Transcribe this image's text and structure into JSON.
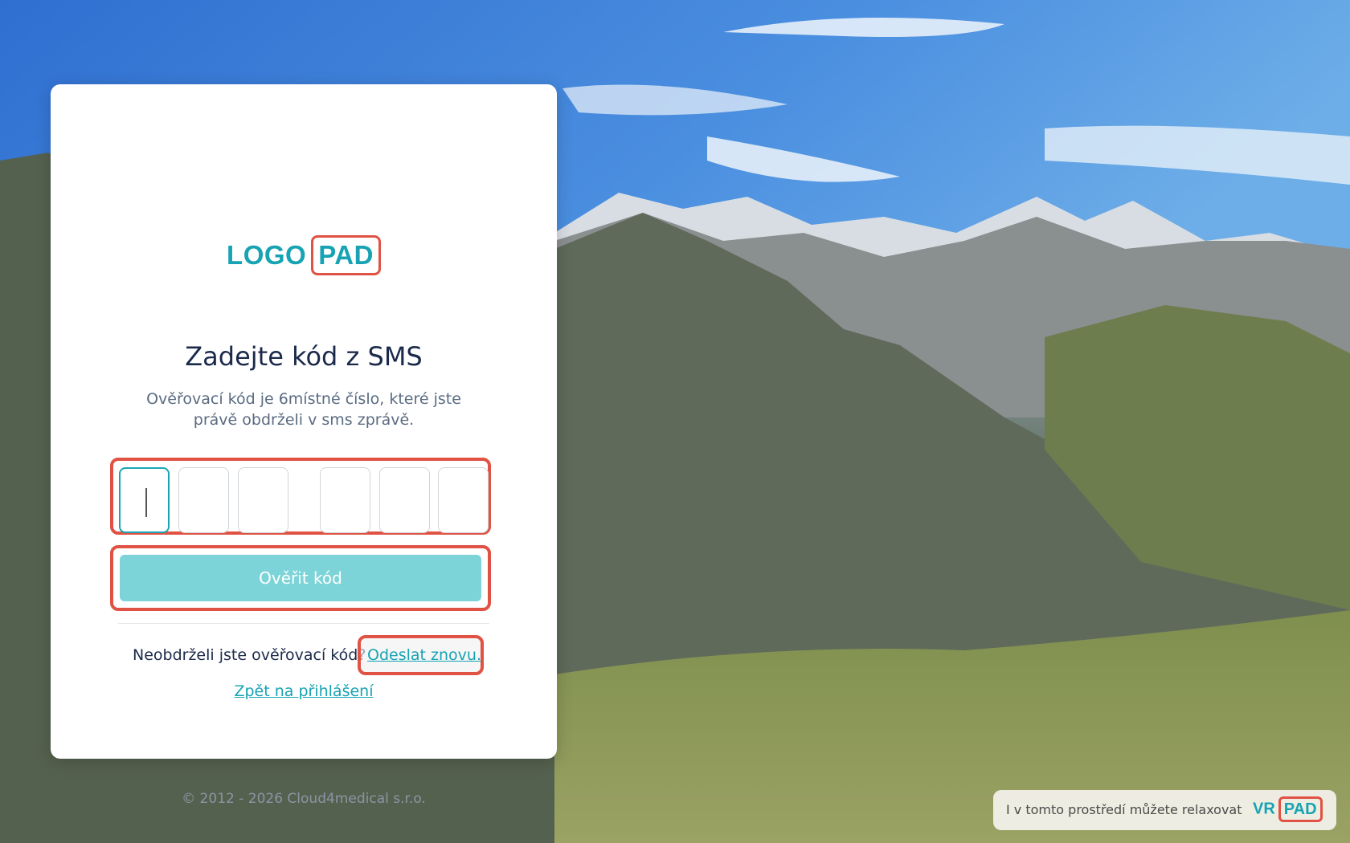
{
  "logo": {
    "part1": "LOGO",
    "part2": "PAD"
  },
  "title": "Zadejte kód z SMS",
  "subtitle": "Ověřovací kód je 6místné číslo, které jste právě obdrželi v sms zprávě.",
  "code": {
    "digits": [
      "",
      "",
      "",
      "",
      "",
      ""
    ],
    "active_index": 0
  },
  "verify_button": "Ověřit kód",
  "resend": {
    "question": "Neobdrželi jste ověřovací kód?",
    "link": "Odeslat znovu."
  },
  "back_link": "Zpět na přihlášení",
  "copyright": "© 2012 - 2026 Cloud4medical s.r.o.",
  "promo": {
    "text": "I v tomto prostředí můžete relaxovat",
    "logo_part1": "VR",
    "logo_part2": "PAD"
  },
  "colors": {
    "brand": "#17a3b3",
    "button": "#7dd4d8",
    "highlight": "#e05244",
    "title": "#1b2a4a"
  }
}
